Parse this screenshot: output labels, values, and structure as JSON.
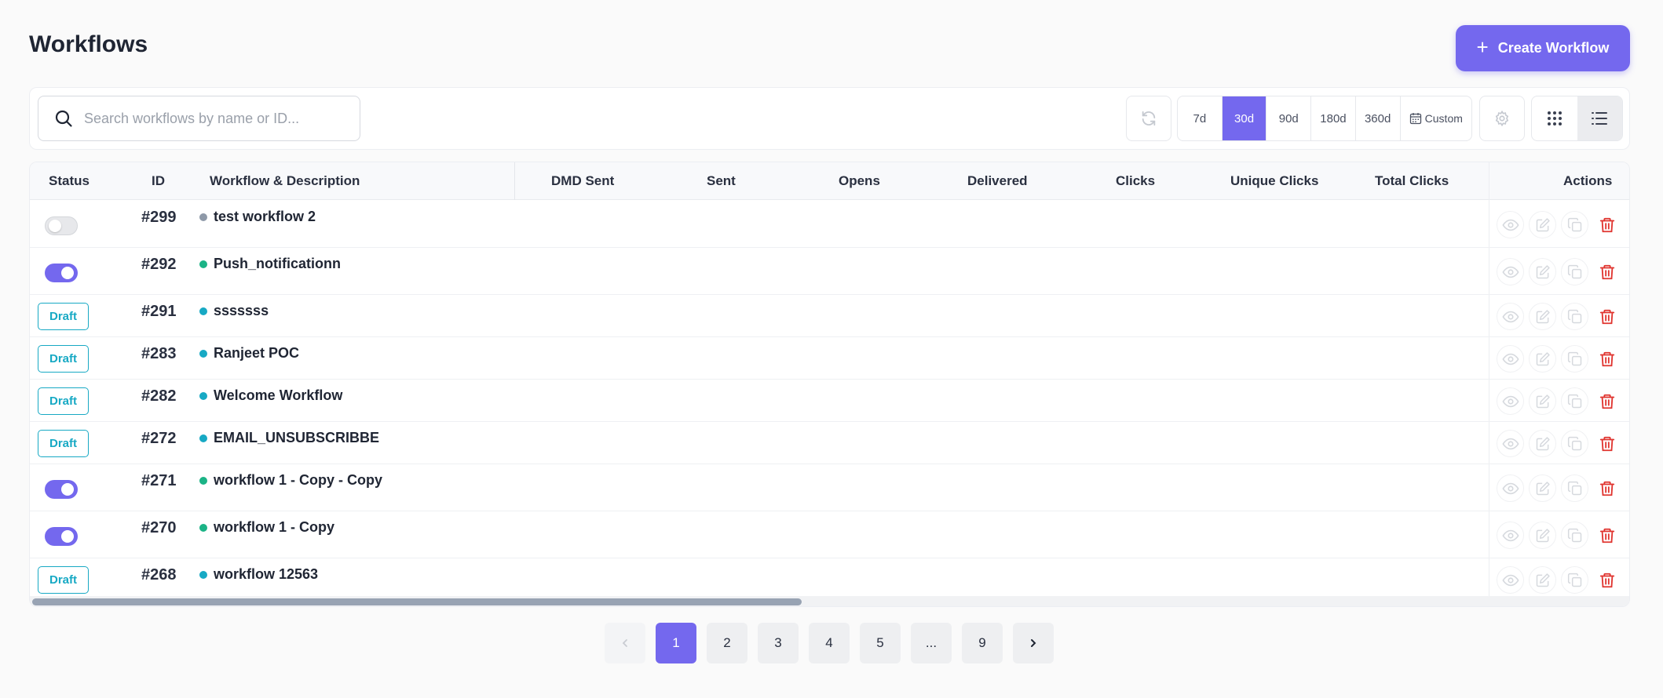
{
  "header": {
    "title": "Workflows",
    "create_label": "Create Workflow"
  },
  "toolbar": {
    "search_placeholder": "Search workflows by name or ID...",
    "ranges": [
      {
        "label": "7d",
        "active": false
      },
      {
        "label": "30d",
        "active": true
      },
      {
        "label": "90d",
        "active": false
      },
      {
        "label": "180d",
        "active": false
      },
      {
        "label": "360d",
        "active": false
      }
    ],
    "custom_label": "Custom"
  },
  "table": {
    "columns": {
      "status": "Status",
      "id": "ID",
      "workflow": "Workflow & Description",
      "dmd_sent": "DMD Sent",
      "sent": "Sent",
      "opens": "Opens",
      "delivered": "Delivered",
      "clicks": "Clicks",
      "unique_clicks": "Unique Clicks",
      "total_clicks": "Total Clicks",
      "actions": "Actions"
    },
    "rows": [
      {
        "status": "toggle-off",
        "id": "#299",
        "name": "test workflow 2",
        "dot": "#8e99a8"
      },
      {
        "status": "toggle-on",
        "id": "#292",
        "name": "Push_notificationn",
        "dot": "#1bb386"
      },
      {
        "status": "draft",
        "draft_label": "Draft",
        "id": "#291",
        "name": "sssssss",
        "dot": "#17a9c4"
      },
      {
        "status": "draft",
        "draft_label": "Draft",
        "id": "#283",
        "name": "Ranjeet POC",
        "dot": "#17a9c4"
      },
      {
        "status": "draft",
        "draft_label": "Draft",
        "id": "#282",
        "name": "Welcome Workflow",
        "dot": "#17a9c4"
      },
      {
        "status": "draft",
        "draft_label": "Draft",
        "id": "#272",
        "name": "EMAIL_UNSUBSCRIBBE",
        "dot": "#17a9c4"
      },
      {
        "status": "toggle-on",
        "id": "#271",
        "name": "workflow 1 - Copy - Copy",
        "dot": "#1bb386"
      },
      {
        "status": "toggle-on",
        "id": "#270",
        "name": "workflow 1 - Copy",
        "dot": "#1bb386"
      },
      {
        "status": "draft",
        "draft_label": "Draft",
        "id": "#268",
        "name": "workflow 12563",
        "dot": "#17a9c4"
      }
    ]
  },
  "pagination": {
    "pages": [
      "1",
      "2",
      "3",
      "4",
      "5",
      "...",
      "9"
    ],
    "current": "1"
  },
  "colors": {
    "accent": "#7468ee",
    "draft": "#17a9c4",
    "active_dot": "#1bb386",
    "inactive_dot": "#8e99a8",
    "delete": "#e0342f"
  },
  "icons": {
    "search": "search-icon",
    "refresh": "refresh-icon",
    "calendar": "calendar-icon",
    "settings": "gear-icon",
    "grid_view": "grid-icon",
    "list_view": "list-icon",
    "view": "eye-icon",
    "edit": "edit-icon",
    "copy": "copy-icon",
    "delete": "trash-icon",
    "prev": "chevron-left-icon",
    "next": "chevron-right-icon"
  }
}
